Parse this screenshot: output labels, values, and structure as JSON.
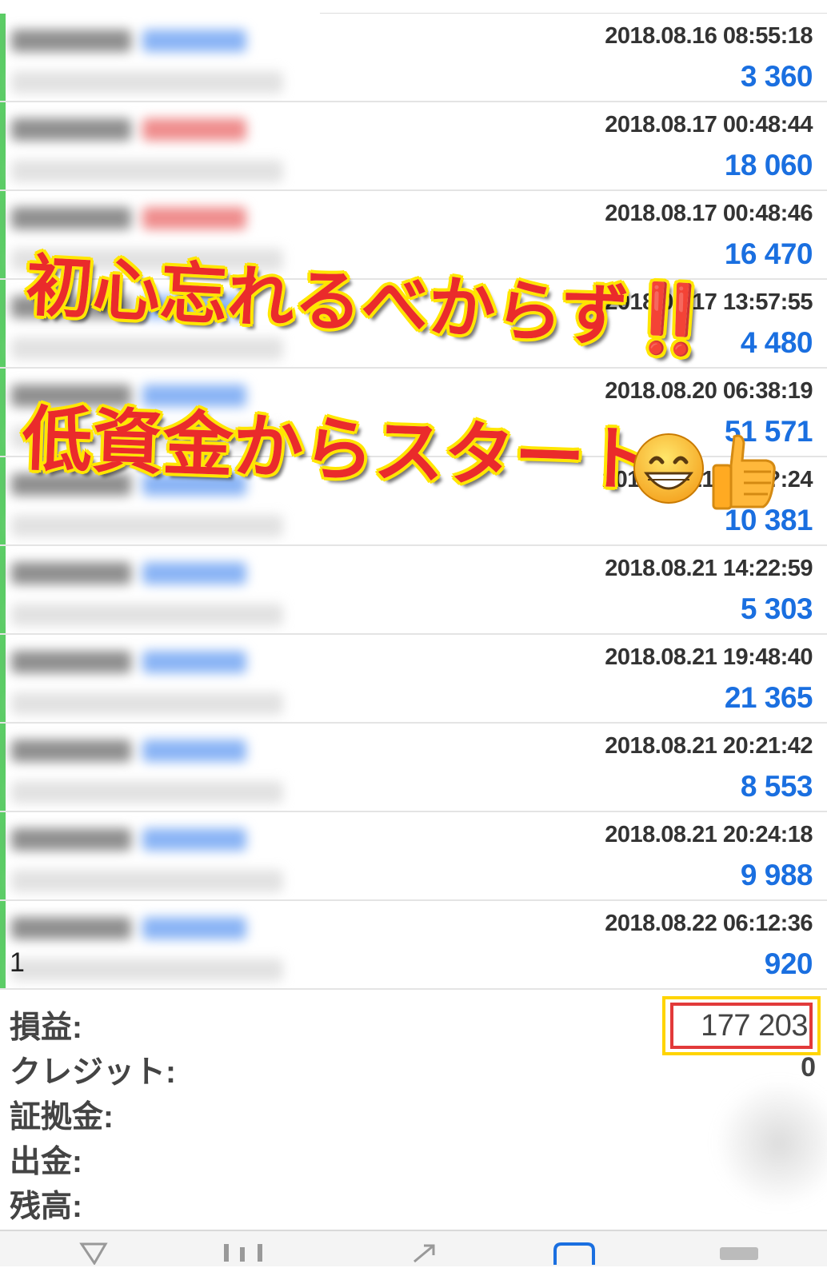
{
  "trades": [
    {
      "side": "buy",
      "date": "2018.08.16 08:55:18",
      "profit": "3 360"
    },
    {
      "side": "sell",
      "date": "2018.08.17 00:48:44",
      "profit": "18 060"
    },
    {
      "side": "sell",
      "date": "2018.08.17 00:48:46",
      "profit": "16 470"
    },
    {
      "side": "buy",
      "date": "2018.08.17 13:57:55",
      "profit": "4 480"
    },
    {
      "side": "buy",
      "date": "2018.08.20 06:38:19",
      "profit": "51 571"
    },
    {
      "side": "buy",
      "date": "2018.08.21 14:??:24",
      "profit": "10 381"
    },
    {
      "side": "buy",
      "date": "2018.08.21 14:22:59",
      "profit": "5 303"
    },
    {
      "side": "buy",
      "date": "2018.08.21 19:48:40",
      "profit": "21 365"
    },
    {
      "side": "buy",
      "date": "2018.08.21 20:21:42",
      "profit": "8 553"
    },
    {
      "side": "buy",
      "date": "2018.08.21 20:24:18",
      "profit": "9 988"
    },
    {
      "side": "buy",
      "date": "2018.08.22 06:12:36",
      "profit": "920"
    }
  ],
  "last_row_prefix": "1",
  "summary": {
    "profit_label": "損益:",
    "profit_value": "177 203",
    "credit_label": "クレジット:",
    "credit_value": "0",
    "margin_label": "証拠金:",
    "withdrawal_label": "出金:",
    "balance_label": "残高:"
  },
  "overlay": {
    "line1": "初心忘れるべからず‼️",
    "line2": "低資金からスタート",
    "emoji_face": "grinning-face",
    "emoji_hand": "thumbs-up"
  },
  "colors": {
    "profit_blue": "#1a6fe0",
    "buy_blue": "#8ab4f5",
    "sell_red": "#ef8d8d",
    "overlay_red": "#ea2b2b",
    "overlay_yellow": "#ffe600",
    "trade_bar_green": "#5ccd66"
  }
}
